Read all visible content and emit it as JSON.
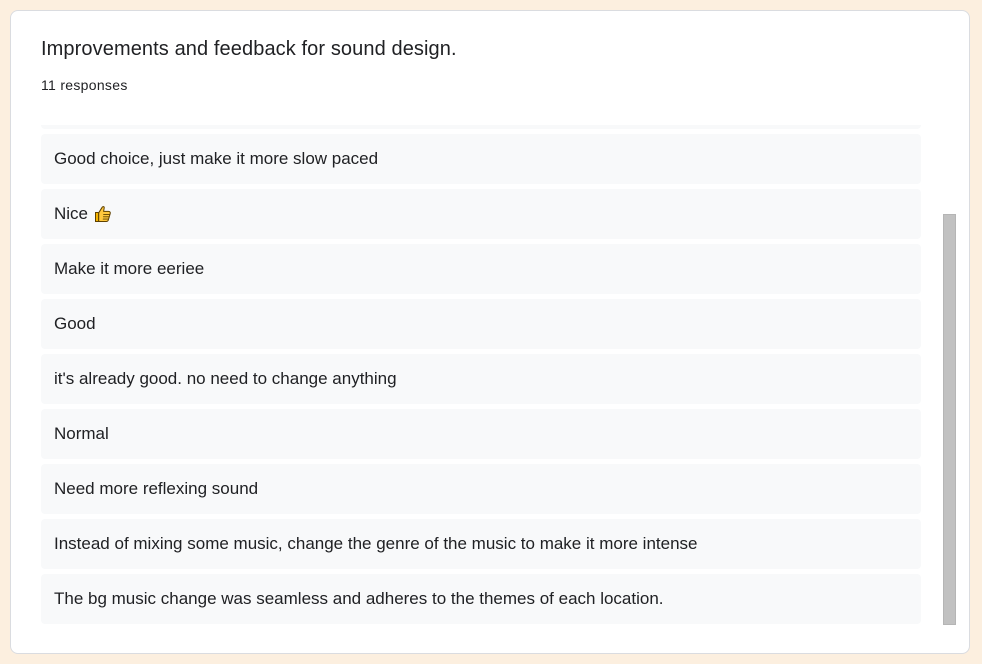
{
  "question": {
    "title": "Improvements and feedback for sound design.",
    "response_count": "11 responses"
  },
  "responses": [
    {
      "text": ""
    },
    {
      "text": "Good choice, just make it more slow paced"
    },
    {
      "text": "Nice",
      "icon": "thumbs-up-icon"
    },
    {
      "text": "Make it more eeriee"
    },
    {
      "text": "Good"
    },
    {
      "text": "it's already good. no need to change anything"
    },
    {
      "text": "Normal"
    },
    {
      "text": "Need more reflexing sound"
    },
    {
      "text": "Instead of mixing some music, change the genre of the music to make it more intense"
    },
    {
      "text": "The bg music change was seamless and adheres to the themes of each location."
    }
  ],
  "colors": {
    "page_background": "#fcefdf",
    "card_background": "#ffffff",
    "response_background": "#f8f9fa",
    "text": "#202124",
    "scrollbar_thumb": "#c1c1c1"
  }
}
